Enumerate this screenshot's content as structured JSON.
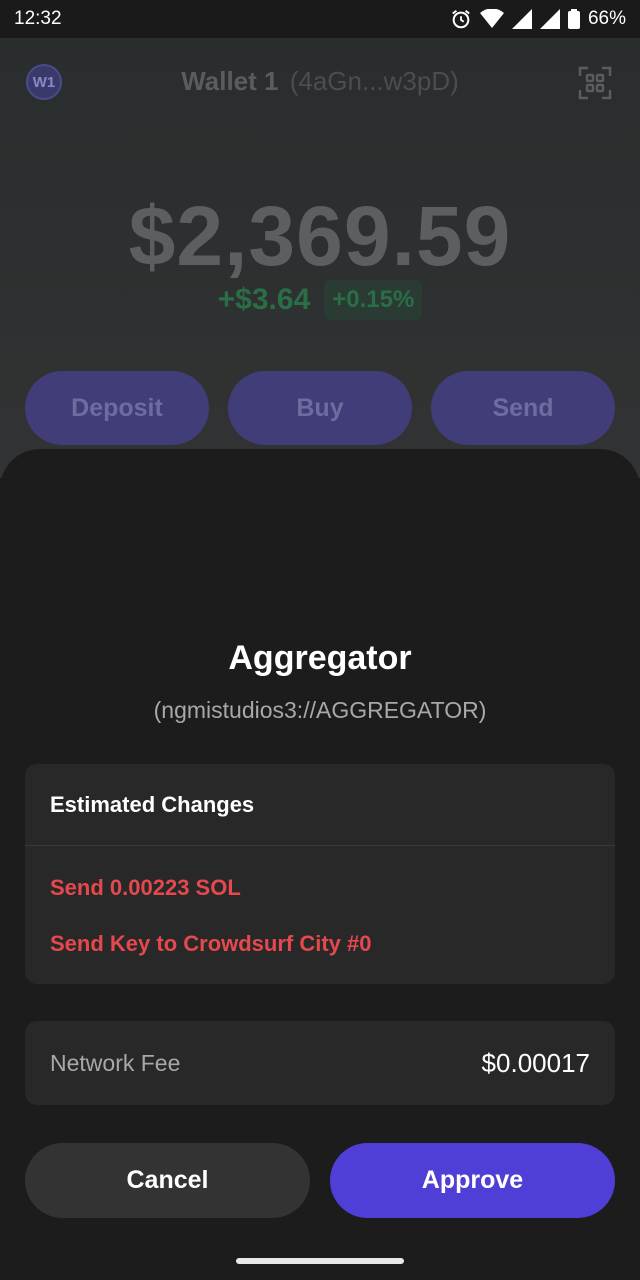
{
  "status_bar": {
    "time": "12:32",
    "battery": "66%"
  },
  "wallet": {
    "avatar_initials": "W1",
    "name": "Wallet 1",
    "address": "(4aGn...w3pD)",
    "balance": "$2,369.59",
    "change_abs": "+$3.64",
    "change_pct": "+0.15%",
    "actions": [
      "Deposit",
      "Buy",
      "Send"
    ]
  },
  "sheet": {
    "app_name": "Aggregator",
    "app_origin": "(ngmistudios3://AGGREGATOR)",
    "changes_title": "Estimated Changes",
    "changes": [
      "Send 0.00223 SOL",
      "Send Key to Crowdsurf City #0"
    ],
    "fee_label": "Network Fee",
    "fee_value": "$0.00017",
    "cancel_label": "Cancel",
    "approve_label": "Approve"
  },
  "colors": {
    "accent": "#4f3fd6",
    "danger": "#e5484d",
    "positive": "#2a6e47"
  },
  "icons": [
    "alarm-icon",
    "wifi-icon",
    "signal-icon",
    "battery-icon",
    "qr-scan-icon"
  ]
}
